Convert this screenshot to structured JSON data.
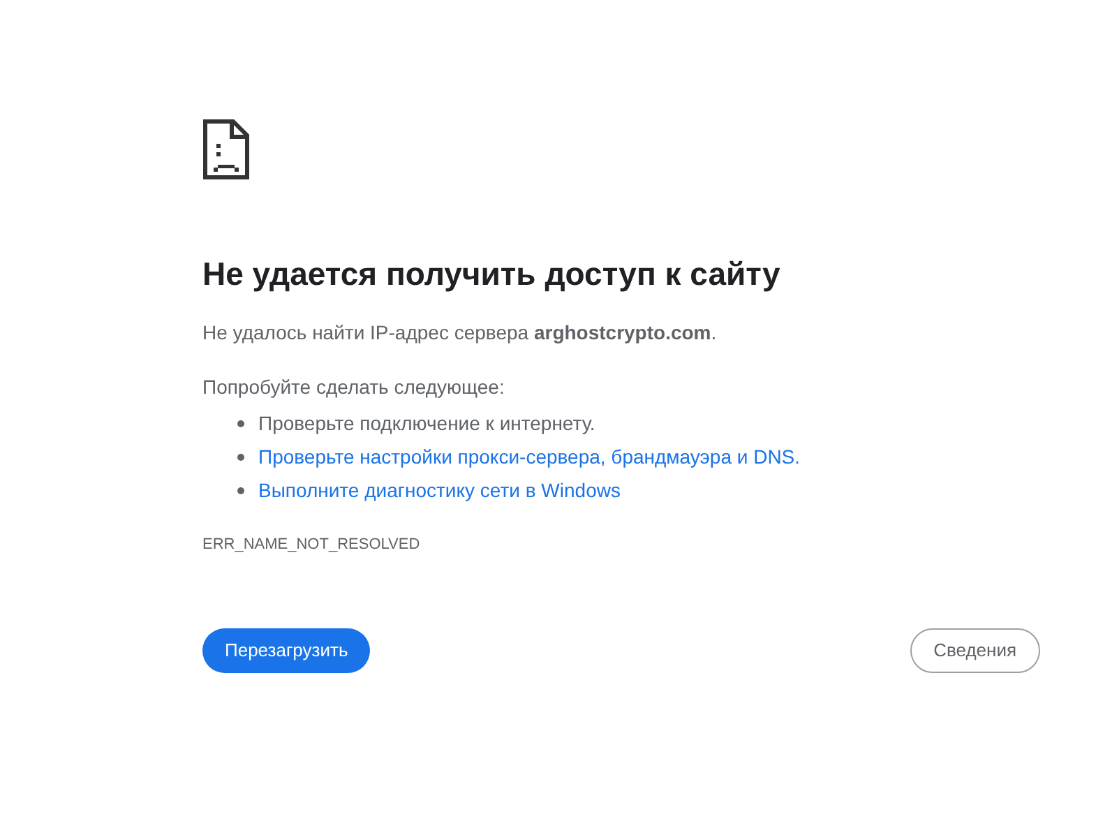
{
  "title": "Не удается получить доступ к сайту",
  "message": "Не удалось найти IP-адрес сервера **arghostcrypto.com**.",
  "suggestions_heading": "Попробуйте сделать следующее:",
  "suggestions": [
    {
      "kind": "text",
      "text": "Проверьте подключение к интернету."
    },
    {
      "kind": "link",
      "text": "Проверьте настройки прокси-сервера, брандмауэра и DNS."
    },
    {
      "kind": "link",
      "text": "Выполните диагностику сети в Windows"
    }
  ],
  "error_code": "ERR_NAME_NOT_RESOLVED",
  "buttons": [
    {
      "kind": "primary",
      "label": "Перезагрузить"
    },
    {
      "kind": "secondary",
      "label": "Сведения"
    }
  ]
}
